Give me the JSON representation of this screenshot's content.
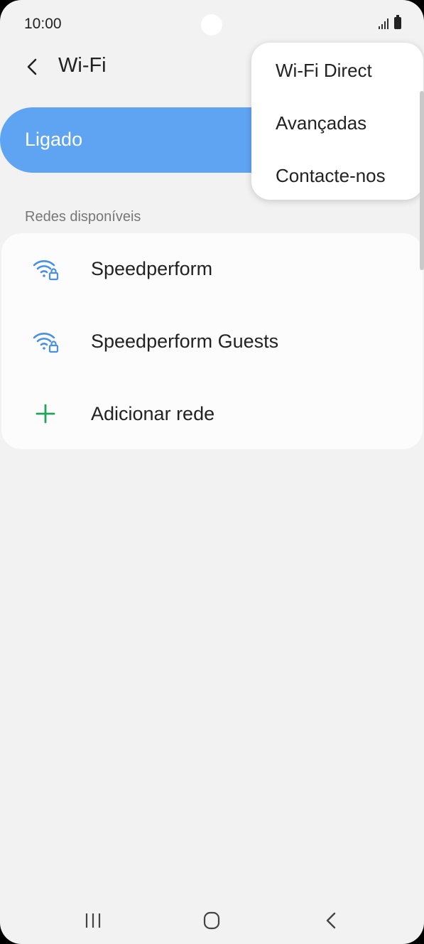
{
  "status_bar": {
    "time": "10:00"
  },
  "header": {
    "title": "Wi-Fi",
    "back_icon": "back-chevron-icon"
  },
  "toggle": {
    "label": "Ligado",
    "color": "#5fa4f3"
  },
  "menu": {
    "items": [
      {
        "label": "Wi-Fi Direct"
      },
      {
        "label": "Avançadas"
      },
      {
        "label": "Contacte-nos"
      }
    ]
  },
  "networks": {
    "section_title": "Redes disponíveis",
    "items": [
      {
        "label": "Speedperform",
        "icon": "wifi-lock-icon"
      },
      {
        "label": "Speedperform Guests",
        "icon": "wifi-lock-icon"
      },
      {
        "label": "Adicionar rede",
        "icon": "plus-icon"
      }
    ],
    "wifi_color": "#4a90e2",
    "plus_color": "#22a35a"
  },
  "nav_bar": {
    "recent": "recent-apps-icon",
    "home": "home-icon",
    "back": "back-icon"
  }
}
